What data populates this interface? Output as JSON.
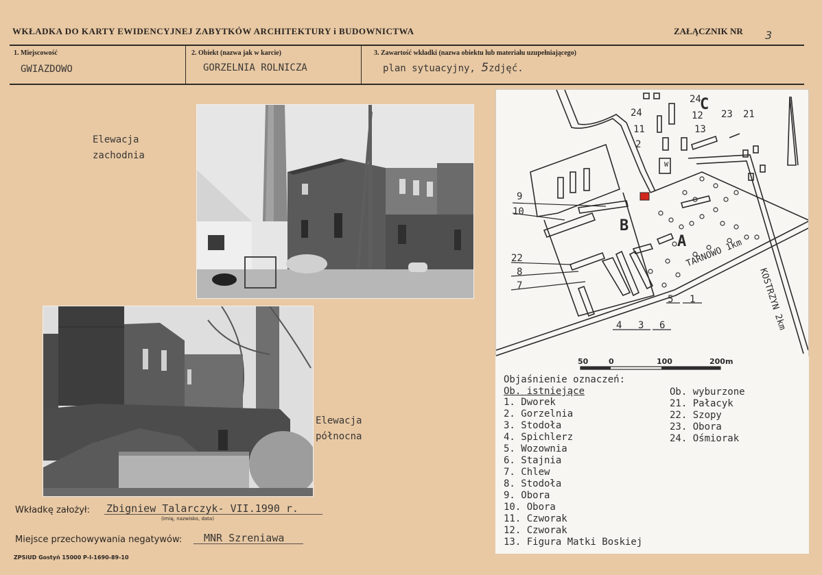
{
  "header": {
    "title": "WKŁADKA DO KARTY EWIDENCYJNEJ ZABYTKÓW ARCHITEKTURY i BUDOWNICTWA",
    "annex_label": "ZAŁĄCZNIK NR",
    "annex_number": "3"
  },
  "fields": {
    "f1_label": "1. Miejscowość",
    "f1_value": "GWIAZDOWO",
    "f2_label": "2. Obiekt (nazwa jak w karcie)",
    "f2_value": "GORZELNIA ROLNICZA",
    "f3_label": "3. Zawartość wkładki (nazwa obiektu lub materiału uzupełniającego)",
    "f3_value_prefix": "plan sytuacyjny,",
    "f3_value_num": "5",
    "f3_value_suffix": "zdjęć."
  },
  "captions": {
    "west_1": "Elewacja",
    "west_2": "zachodnia",
    "north_1": "Elewacja",
    "north_2": "północna"
  },
  "map": {
    "labels": {
      "A": "A",
      "B": "B",
      "C": "C",
      "road1": "TARNOWO 1km",
      "road2": "KOSTRZYN 2km",
      "W": "W"
    },
    "numbers": [
      "24",
      "12",
      "23",
      "21",
      "24",
      "11",
      "13",
      "2",
      "9",
      "10",
      "22",
      "8",
      "7",
      "4",
      "3",
      "6",
      "5",
      "1"
    ],
    "scale": [
      "50",
      "0",
      "100",
      "200m"
    ]
  },
  "legend": {
    "heading": "Objaśnienie oznaczeń:",
    "existing_heading": "Ob. istniejące",
    "existing": [
      "1. Dworek",
      "2. Gorzelnia",
      "3. Stodoła",
      "4. Spichlerz",
      "5. Wozownia",
      "6. Stajnia",
      "7. Chlew",
      "8. Stodoła",
      "9. Obora",
      "10. Obora",
      "11. Czworak",
      "12. Czworak",
      "13. Figura Matki Boskiej"
    ],
    "demolished_heading": "Ob. wyburzone",
    "demolished": [
      "21. Pałacyk",
      "22. Szopy",
      "23. Obora",
      "24. Ośmiorak"
    ]
  },
  "footer": {
    "author_label": "Wkładkę założył:",
    "author_value": "Zbigniew Talarczyk- VII.1990 r.",
    "author_hint": "(imię, nazwisko, data)",
    "storage_label": "Miejsce przechowywania negatywów:",
    "storage_value": "MNR Szreniawa",
    "printer": "ZPSiUD Gostyń 15000 P-I-1690-89-10"
  },
  "colors": {
    "card": "#e8c9a4",
    "ink": "#2a2420",
    "marker": "#d2261c"
  }
}
